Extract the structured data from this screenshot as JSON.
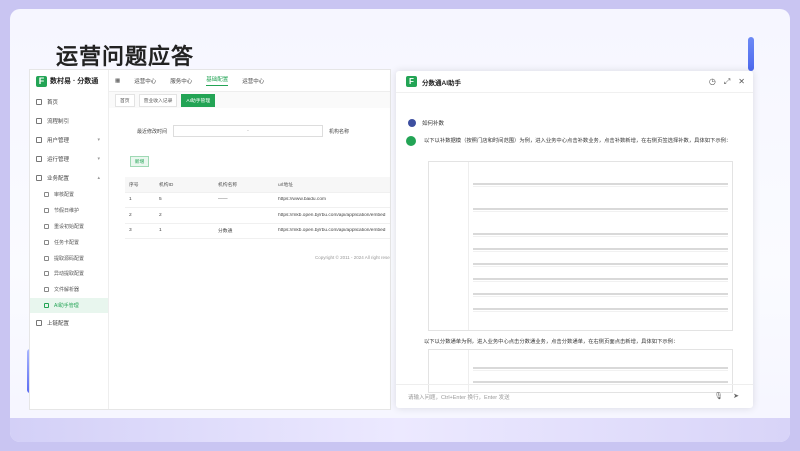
{
  "slide": {
    "title": "运营问题应答"
  },
  "app": {
    "logo_text": "数村易 · 分数通",
    "logo_mark": "F",
    "sidebar": [
      {
        "label": "首页",
        "icon": "home-icon"
      },
      {
        "label": "流程制引",
        "icon": "pin-icon"
      },
      {
        "label": "用户管理",
        "icon": "user-icon"
      },
      {
        "label": "运行管理",
        "icon": "settings-icon"
      },
      {
        "label": "业务配置",
        "icon": "config-icon"
      }
    ],
    "sub_items": [
      "审核配置",
      "节假日维护",
      "重设初始配置",
      "任务卡配置",
      "提取源码配置",
      "异动提取配置",
      "文件解析器",
      "AI助手管理"
    ],
    "sidebar_bottom": "上链配置",
    "top_tabs": [
      "运营中心",
      "服务中心",
      "基础配置",
      "运营中心"
    ],
    "breadcrumbs": [
      "首页",
      "营业收入记录",
      "AI助手管理"
    ],
    "filters": {
      "label1": "最近修改时间",
      "sep": "-",
      "label2": "机构名称"
    },
    "new_button": "新增",
    "table": {
      "headers": [
        "序号",
        "机构ID",
        "机构名称",
        "url地址"
      ],
      "rows": [
        [
          "1",
          "5",
          "——",
          "https://www.baidu.com"
        ],
        [
          "2",
          "2",
          "",
          "https://mkb.open.bjrrbu.com/api/application/embed"
        ],
        [
          "3",
          "1",
          "分数通",
          "https://mkb.open.bjrrbu.com/api/application/embed"
        ]
      ]
    },
    "copyright": "Copyright © 2011 - 2024 All right rese"
  },
  "panel": {
    "title": "分数通AI助手",
    "logo_mark": "F",
    "user_question": "如何补数",
    "answer": "以下以补数据模（按照门店和时间范围）为例，进入业务中心点击补数业务，点击补数新增，在右侧页签选择补数，具体如下示例：",
    "answer2": "以下以分数通单为例，进入业务中心点击分数通业务，点击分数通单，在右侧页面点击新增，具体如下示例：",
    "input_placeholder": "请输入问题，Ctrl+Enter 换行，Enter 发送",
    "tools": [
      "history-icon",
      "expand-icon",
      "close-icon"
    ]
  }
}
